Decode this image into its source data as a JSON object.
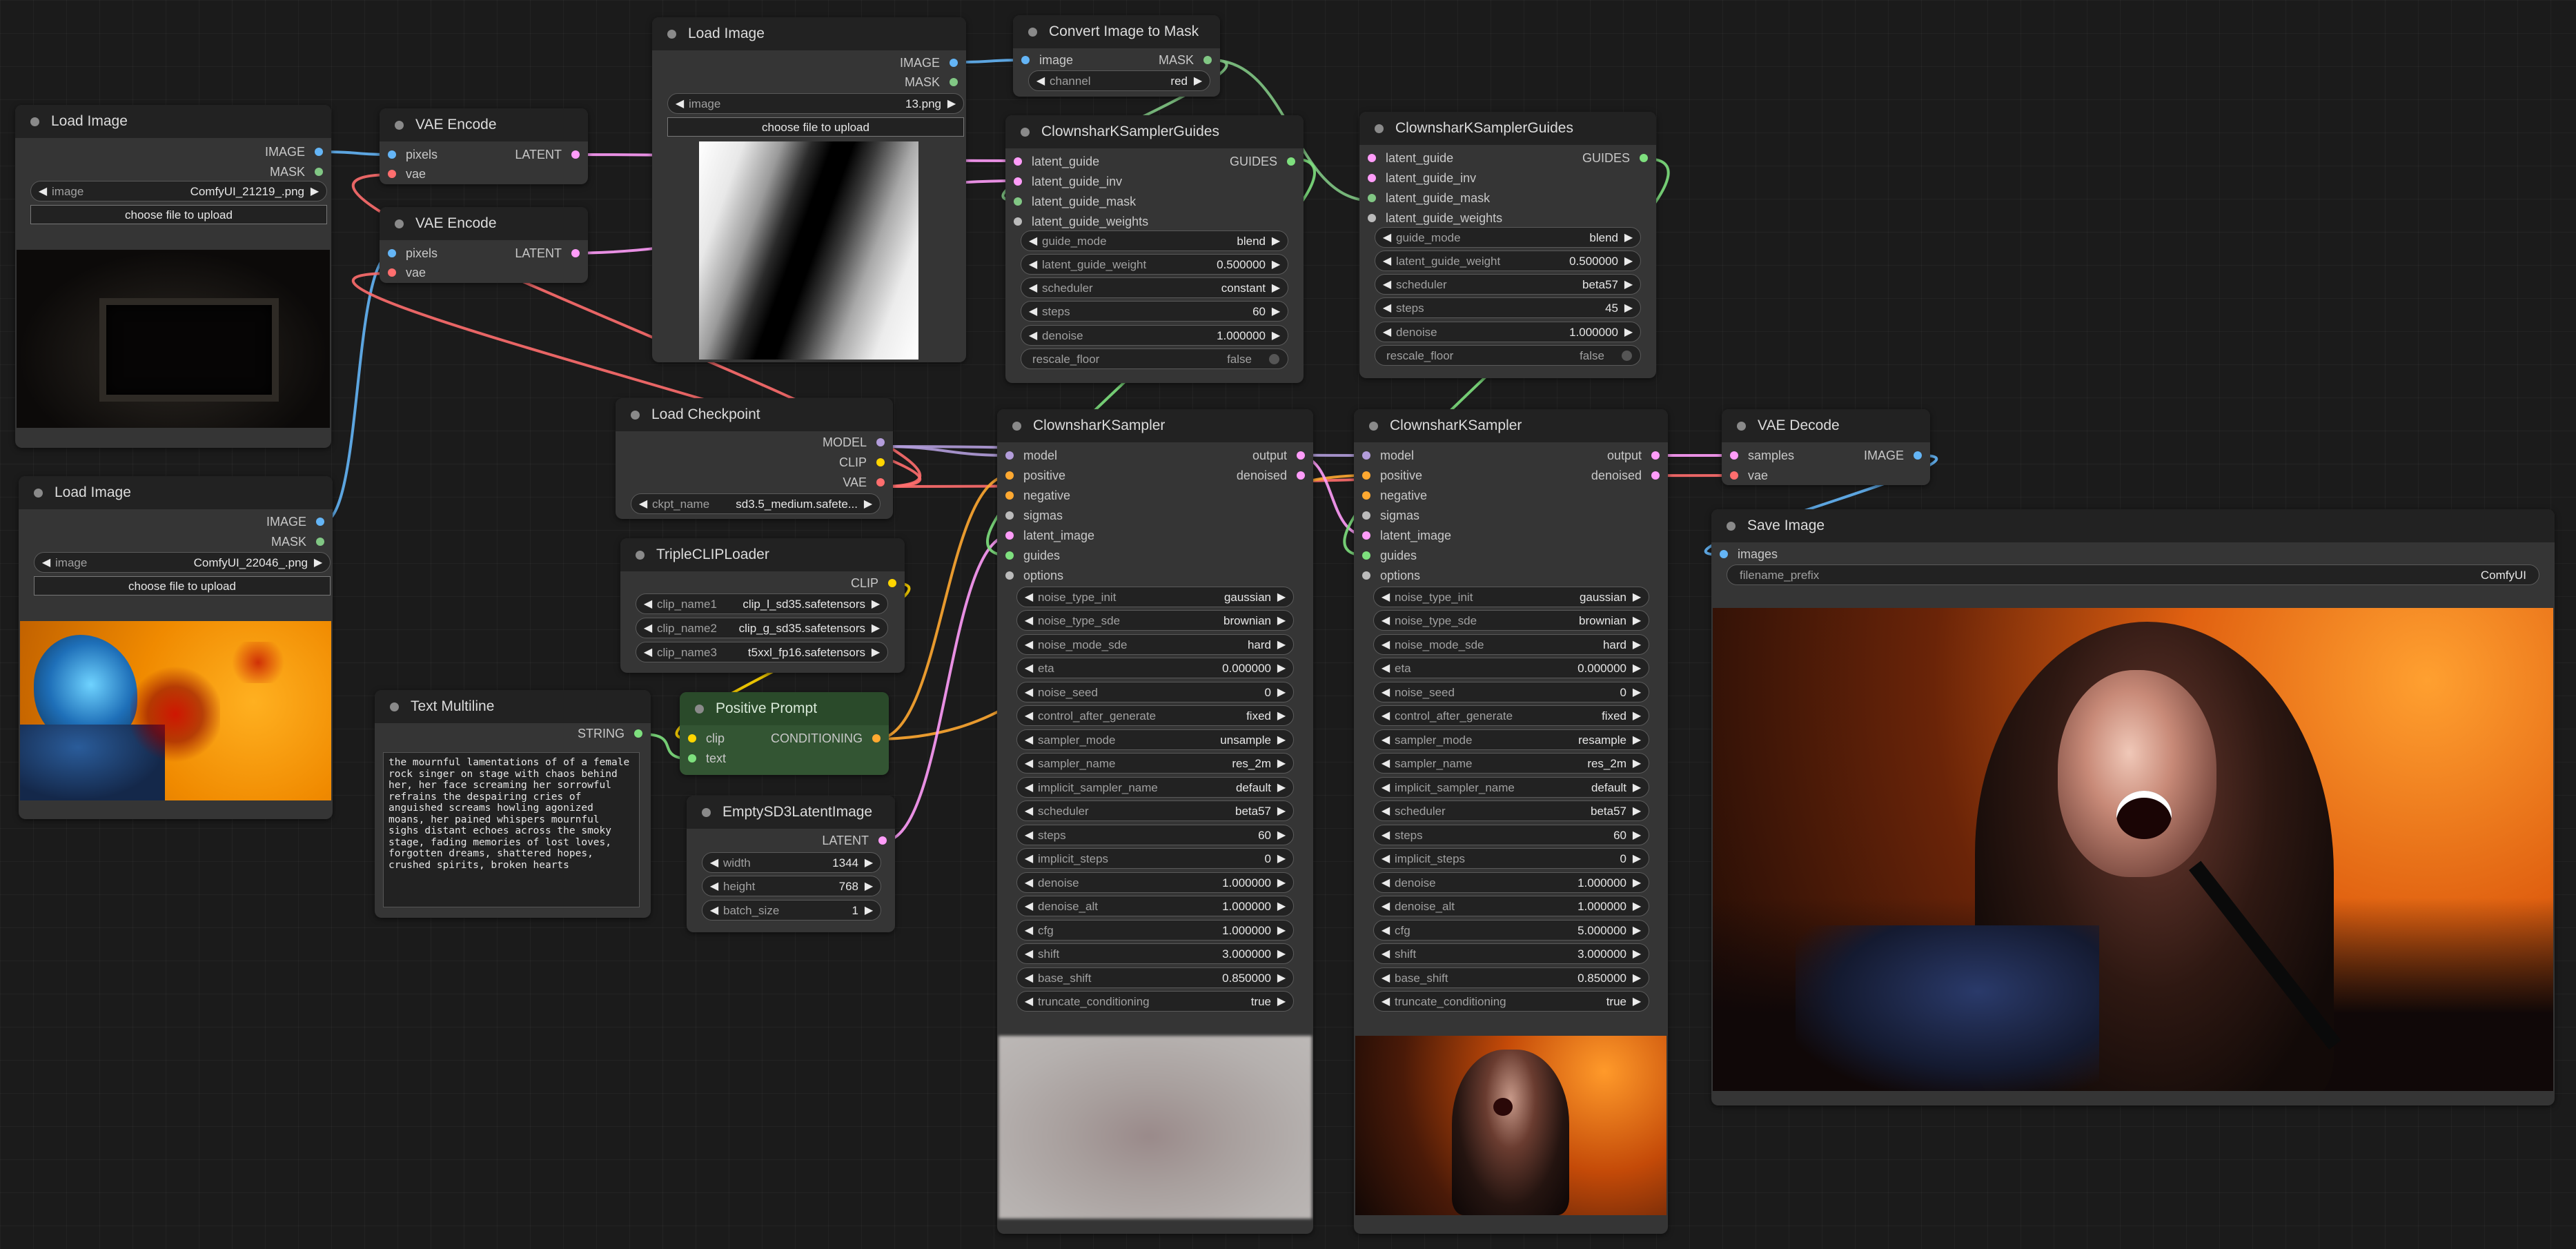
{
  "colors": {
    "IMAGE": "#64b5f6",
    "MASK": "#81c784",
    "LATENT": "#ff9cf9",
    "MODEL": "#b39ddb",
    "CLIP": "#ffd500",
    "VAE": "#ff6e6e",
    "CONDITIONING": "#ffa931",
    "STRING": "#7ee07e",
    "GUIDES": "#7ee07e",
    "SIGMAS": "#bbbbbb",
    "OPTIONS": "#bbbbbb"
  },
  "nodes": {
    "load_image_1": {
      "title": "Load Image",
      "out_image": "IMAGE",
      "out_mask": "MASK",
      "image_label": "image",
      "image_value": "ComfyUI_21219_.png",
      "upload": "choose file to upload"
    },
    "load_image_2": {
      "title": "Load Image",
      "out_image": "IMAGE",
      "out_mask": "MASK",
      "image_label": "image",
      "image_value": "ComfyUI_22046_.png",
      "upload": "choose file to upload"
    },
    "load_image_3": {
      "title": "Load Image",
      "out_image": "IMAGE",
      "out_mask": "MASK",
      "image_label": "image",
      "image_value": "13.png",
      "upload": "choose file to upload"
    },
    "vae_encode_1": {
      "title": "VAE Encode",
      "in_pixels": "pixels",
      "in_vae": "vae",
      "out_latent": "LATENT"
    },
    "vae_encode_2": {
      "title": "VAE Encode",
      "in_pixels": "pixels",
      "in_vae": "vae",
      "out_latent": "LATENT"
    },
    "convert_mask": {
      "title": "Convert Image to Mask",
      "in_image": "image",
      "out_mask": "MASK",
      "channel_label": "channel",
      "channel_value": "red"
    },
    "guides_1": {
      "title": "ClownsharKSamplerGuides",
      "inputs": [
        "latent_guide",
        "latent_guide_inv",
        "latent_guide_mask",
        "latent_guide_weights"
      ],
      "out": "GUIDES",
      "widgets": [
        [
          "guide_mode",
          "blend"
        ],
        [
          "latent_guide_weight",
          "0.500000"
        ],
        [
          "scheduler",
          "constant"
        ],
        [
          "steps",
          "60"
        ],
        [
          "denoise",
          "1.000000"
        ]
      ],
      "toggle": [
        "rescale_floor",
        "false"
      ]
    },
    "guides_2": {
      "title": "ClownsharKSamplerGuides",
      "inputs": [
        "latent_guide",
        "latent_guide_inv",
        "latent_guide_mask",
        "latent_guide_weights"
      ],
      "out": "GUIDES",
      "widgets": [
        [
          "guide_mode",
          "blend"
        ],
        [
          "latent_guide_weight",
          "0.500000"
        ],
        [
          "scheduler",
          "beta57"
        ],
        [
          "steps",
          "45"
        ],
        [
          "denoise",
          "1.000000"
        ]
      ],
      "toggle": [
        "rescale_floor",
        "false"
      ]
    },
    "load_checkpoint": {
      "title": "Load Checkpoint",
      "out_model": "MODEL",
      "out_clip": "CLIP",
      "out_vae": "VAE",
      "ckpt_label": "ckpt_name",
      "ckpt_value": "sd3.5_medium.safete..."
    },
    "triple_clip": {
      "title": "TripleCLIPLoader",
      "out_clip": "CLIP",
      "widgets": [
        [
          "clip_name1",
          "clip_l_sd35.safetensors"
        ],
        [
          "clip_name2",
          "clip_g_sd35.safetensors"
        ],
        [
          "clip_name3",
          "t5xxl_fp16.safetensors"
        ]
      ]
    },
    "text_multiline": {
      "title": "Text Multiline",
      "out": "STRING",
      "text": "the mournful lamentations of of a female rock singer on stage with chaos behind her, her face screaming her sorrowful refrains the despairing cries of anguished screams howling agonized moans, her pained whispers mournful sighs distant echoes across the smoky stage, fading memories of lost loves, forgotten dreams, shattered hopes, crushed spirits, broken hearts"
    },
    "positive_prompt": {
      "title": "Positive Prompt",
      "in_clip": "clip",
      "in_text": "text",
      "out": "CONDITIONING"
    },
    "empty_latent": {
      "title": "EmptySD3LatentImage",
      "out": "LATENT",
      "widgets": [
        [
          "width",
          "1344"
        ],
        [
          "height",
          "768"
        ],
        [
          "batch_size",
          "1"
        ]
      ]
    },
    "sampler_1": {
      "title": "ClownsharKSampler",
      "inputs": [
        "model",
        "positive",
        "negative",
        "sigmas",
        "latent_image",
        "guides",
        "options"
      ],
      "out_output": "output",
      "out_denoised": "denoised",
      "widgets": [
        [
          "noise_type_init",
          "gaussian"
        ],
        [
          "noise_type_sde",
          "brownian"
        ],
        [
          "noise_mode_sde",
          "hard"
        ],
        [
          "eta",
          "0.000000"
        ],
        [
          "noise_seed",
          "0"
        ],
        [
          "control_after_generate",
          "fixed"
        ],
        [
          "sampler_mode",
          "unsample"
        ],
        [
          "sampler_name",
          "res_2m"
        ],
        [
          "implicit_sampler_name",
          "default"
        ],
        [
          "scheduler",
          "beta57"
        ],
        [
          "steps",
          "60"
        ],
        [
          "implicit_steps",
          "0"
        ],
        [
          "denoise",
          "1.000000"
        ],
        [
          "denoise_alt",
          "1.000000"
        ],
        [
          "cfg",
          "1.000000"
        ],
        [
          "shift",
          "3.000000"
        ],
        [
          "base_shift",
          "0.850000"
        ],
        [
          "truncate_conditioning",
          "true"
        ]
      ]
    },
    "sampler_2": {
      "title": "ClownsharKSampler",
      "inputs": [
        "model",
        "positive",
        "negative",
        "sigmas",
        "latent_image",
        "guides",
        "options"
      ],
      "out_output": "output",
      "out_denoised": "denoised",
      "widgets": [
        [
          "noise_type_init",
          "gaussian"
        ],
        [
          "noise_type_sde",
          "brownian"
        ],
        [
          "noise_mode_sde",
          "hard"
        ],
        [
          "eta",
          "0.000000"
        ],
        [
          "noise_seed",
          "0"
        ],
        [
          "control_after_generate",
          "fixed"
        ],
        [
          "sampler_mode",
          "resample"
        ],
        [
          "sampler_name",
          "res_2m"
        ],
        [
          "implicit_sampler_name",
          "default"
        ],
        [
          "scheduler",
          "beta57"
        ],
        [
          "steps",
          "60"
        ],
        [
          "implicit_steps",
          "0"
        ],
        [
          "denoise",
          "1.000000"
        ],
        [
          "denoise_alt",
          "1.000000"
        ],
        [
          "cfg",
          "5.000000"
        ],
        [
          "shift",
          "3.000000"
        ],
        [
          "base_shift",
          "0.850000"
        ],
        [
          "truncate_conditioning",
          "true"
        ]
      ]
    },
    "vae_decode": {
      "title": "VAE Decode",
      "in_samples": "samples",
      "in_vae": "vae",
      "out": "IMAGE"
    },
    "save_image": {
      "title": "Save Image",
      "in_images": "images",
      "prefix_label": "filename_prefix",
      "prefix_value": "ComfyUI"
    }
  }
}
